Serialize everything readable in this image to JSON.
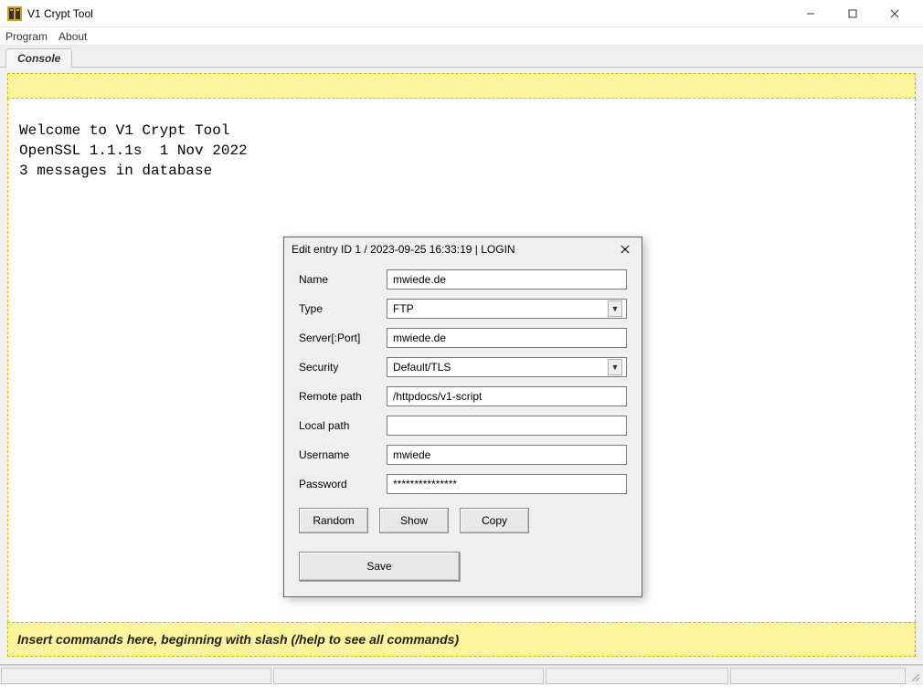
{
  "window": {
    "title": "V1 Crypt Tool"
  },
  "menu": {
    "program": "Program",
    "about": "About"
  },
  "tabs": {
    "console": "Console"
  },
  "console": {
    "line1": "Welcome to V1 Crypt Tool",
    "line2": "OpenSSL 1.1.1s  1 Nov 2022",
    "line3": "3 messages in database"
  },
  "command_placeholder": "Insert commands here, beginning with slash (/help to see all commands)",
  "dialog": {
    "title": "Edit entry ID 1 / 2023-09-25 16:33:19 | LOGIN",
    "labels": {
      "name": "Name",
      "type": "Type",
      "server": "Server[:Port]",
      "security": "Security",
      "remote_path": "Remote path",
      "local_path": "Local path",
      "username": "Username",
      "password": "Password"
    },
    "values": {
      "name": "mwiede.de",
      "type": "FTP",
      "server": "mwiede.de",
      "security": "Default/TLS",
      "remote_path": "/httpdocs/v1-script",
      "local_path": "",
      "username": "mwiede",
      "password": "***************"
    },
    "buttons": {
      "random": "Random",
      "show": "Show",
      "copy": "Copy",
      "save": "Save"
    }
  }
}
